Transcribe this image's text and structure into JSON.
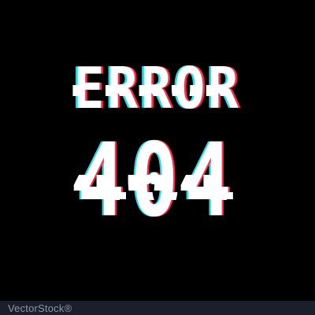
{
  "error_word": "ERROR",
  "error_code": "404",
  "watermark": "VectorStock®",
  "colors": {
    "background": "#000000",
    "main_text": "#ffffff",
    "glitch_cyan": "#2ad8e8",
    "glitch_red": "#ff2a52"
  }
}
